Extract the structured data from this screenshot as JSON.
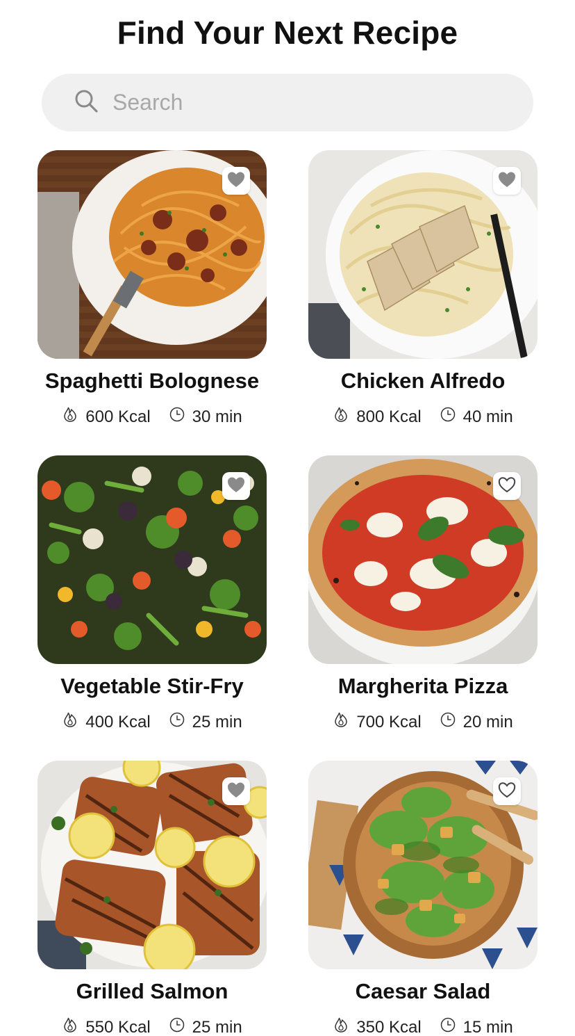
{
  "page_title": "Find Your Next Recipe",
  "search": {
    "placeholder": "Search",
    "value": ""
  },
  "recipes": [
    {
      "name": "Spaghetti Bolognese",
      "calories": "600 Kcal",
      "time": "30 min",
      "favorite": "filled",
      "image": "spaghetti-bolognese-photo"
    },
    {
      "name": "Chicken Alfredo",
      "calories": "800 Kcal",
      "time": "40 min",
      "favorite": "filled",
      "image": "chicken-alfredo-photo"
    },
    {
      "name": "Vegetable Stir-Fry",
      "calories": "400 Kcal",
      "time": "25 min",
      "favorite": "filled",
      "image": "vegetable-stir-fry-photo"
    },
    {
      "name": "Margherita Pizza",
      "calories": "700 Kcal",
      "time": "20 min",
      "favorite": "outline",
      "image": "margherita-pizza-photo"
    },
    {
      "name": "Grilled Salmon",
      "calories": "550 Kcal",
      "time": "25 min",
      "favorite": "filled",
      "image": "grilled-salmon-photo"
    },
    {
      "name": "Caesar Salad",
      "calories": "350 Kcal",
      "time": "15 min",
      "favorite": "outline",
      "image": "caesar-salad-photo"
    }
  ],
  "icons": {
    "search": "search-icon",
    "calories": "flame-icon",
    "time": "clock-icon",
    "favorite": "heart-icon"
  },
  "colors": {
    "search_background": "#f0f0f0",
    "placeholder": "#a8a8a8",
    "heart_filled": "#8a8a8a",
    "text": "#111111"
  }
}
